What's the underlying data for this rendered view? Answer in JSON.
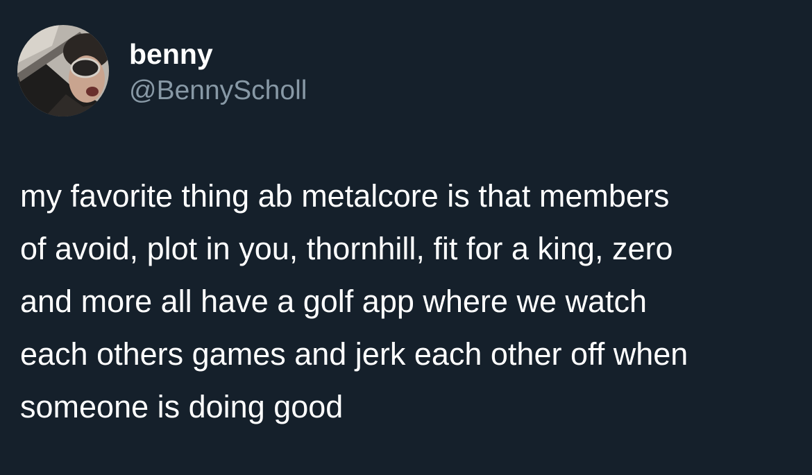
{
  "colors": {
    "background": "#15202b",
    "text_primary": "#ffffff",
    "text_secondary": "#8899a6"
  },
  "author": {
    "avatar_icon": "profile-photo-icon",
    "display_name": "benny",
    "handle": "@BennyScholl"
  },
  "tweet": {
    "lines": [
      "my favorite thing ab metalcore is that members",
      "of avoid, plot in you, thornhill, fit for a king, zero",
      "and more all have a golf app where we watch",
      "each others games and jerk each other off when",
      "someone is doing good"
    ]
  }
}
